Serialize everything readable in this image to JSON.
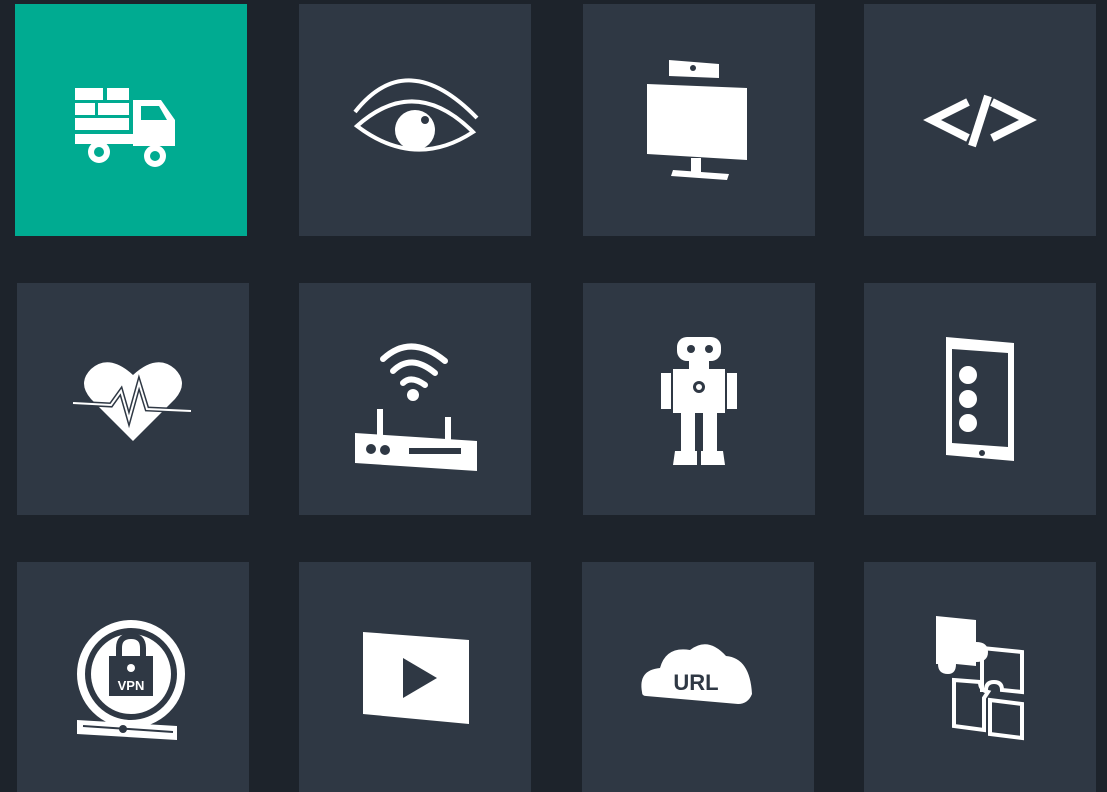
{
  "colors": {
    "background": "#1d232b",
    "tile": "#2f3844",
    "tile_active": "#00ab91",
    "icon": "#ffffff"
  },
  "tiles": [
    {
      "icon": "delivery-truck-icon",
      "active": true
    },
    {
      "icon": "eye-icon",
      "active": false
    },
    {
      "icon": "monitor-webcam-icon",
      "active": false
    },
    {
      "icon": "code-icon",
      "active": false,
      "label": "</>"
    },
    {
      "icon": "heartbeat-icon",
      "active": false
    },
    {
      "icon": "wifi-router-icon",
      "active": false
    },
    {
      "icon": "robot-icon",
      "active": false
    },
    {
      "icon": "tablet-menu-icon",
      "active": false
    },
    {
      "icon": "vpn-lock-icon",
      "active": false,
      "label": "VPN"
    },
    {
      "icon": "video-play-icon",
      "active": false
    },
    {
      "icon": "url-cloud-icon",
      "active": false,
      "label": "URL"
    },
    {
      "icon": "puzzle-icon",
      "active": false
    }
  ]
}
